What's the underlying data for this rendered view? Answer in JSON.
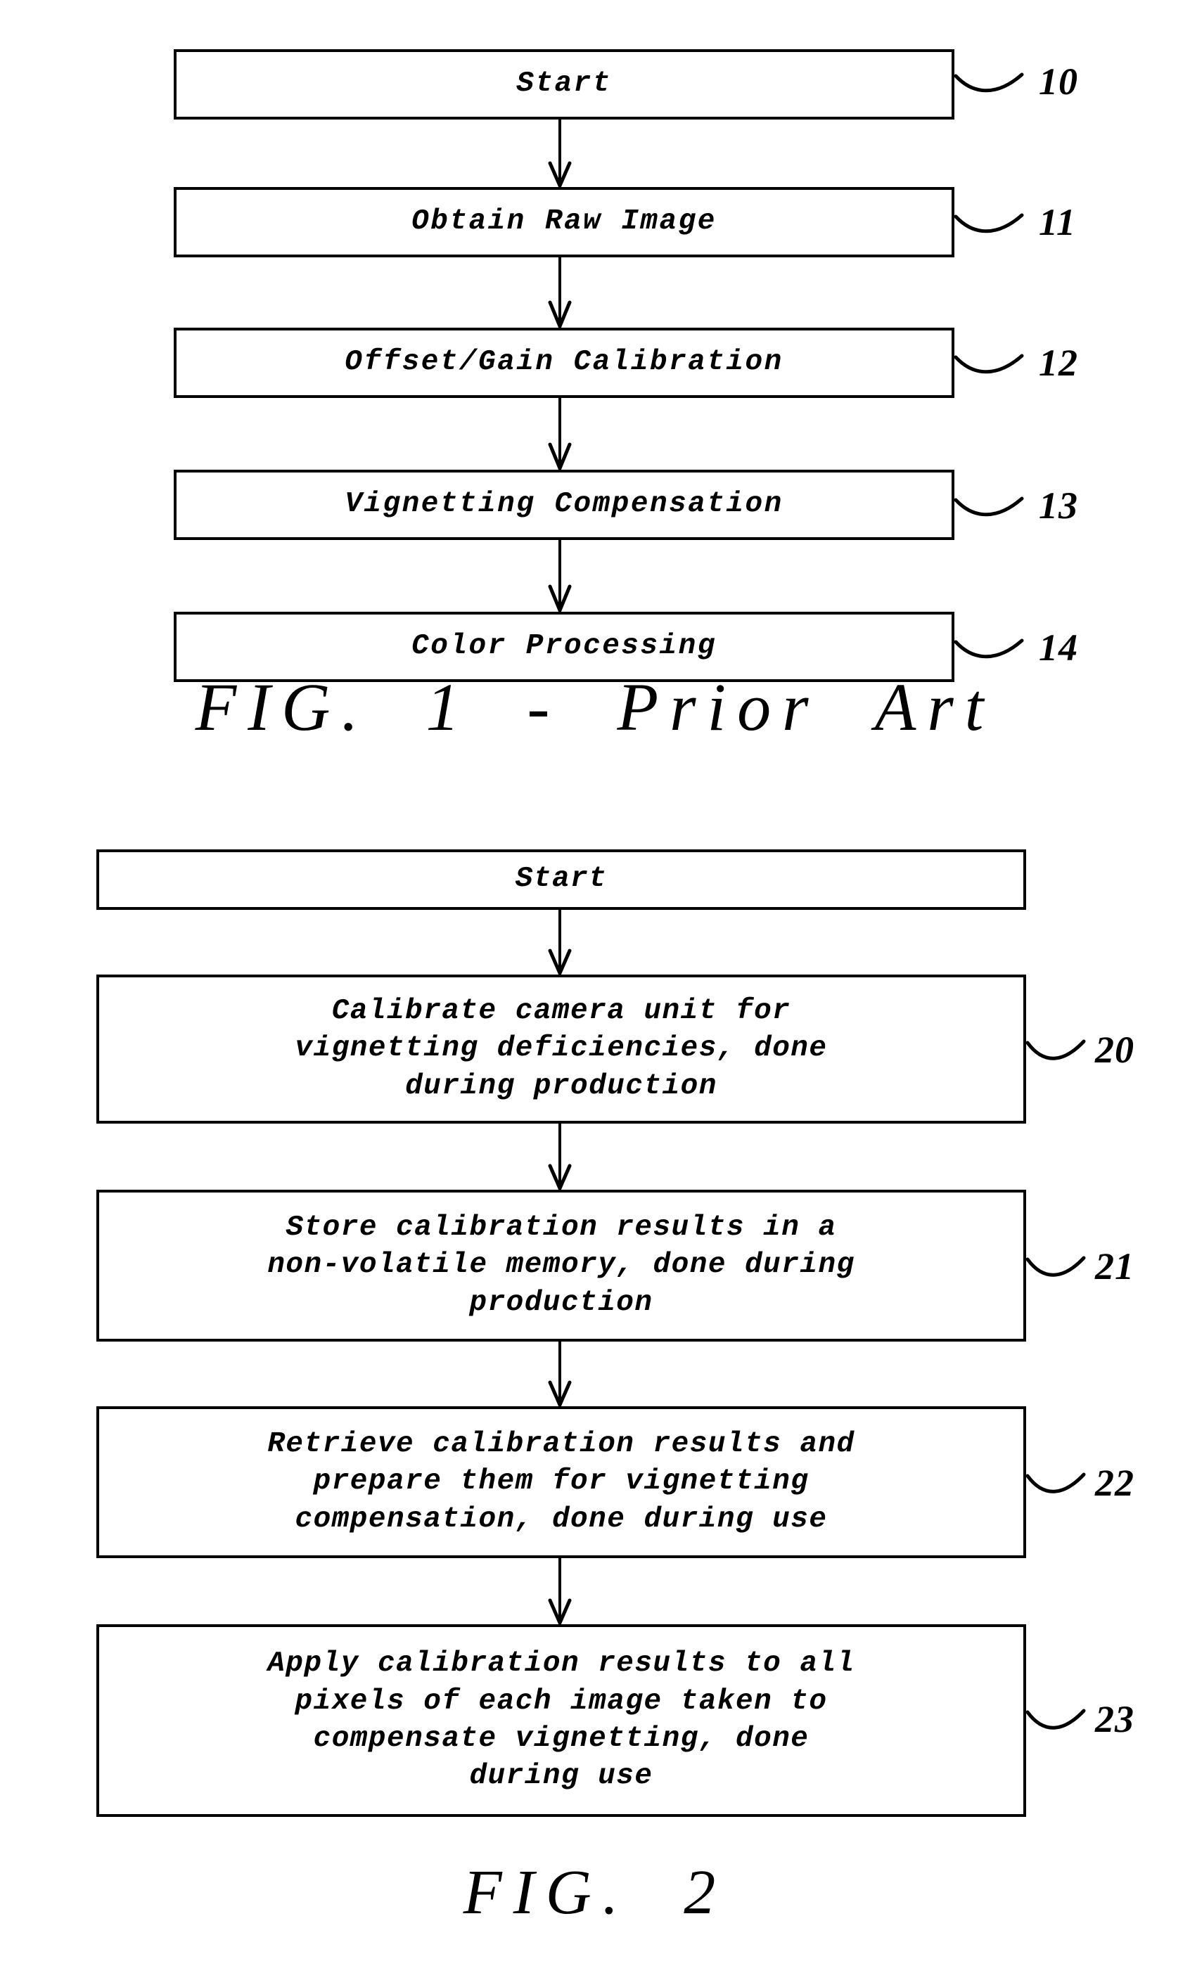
{
  "figures": [
    {
      "id": "fig1",
      "caption": "FIG.  1  -  Prior  Art",
      "steps": [
        {
          "label": "Start",
          "ref": "10"
        },
        {
          "label": "Obtain Raw Image",
          "ref": "11"
        },
        {
          "label": "Offset/Gain Calibration",
          "ref": "12"
        },
        {
          "label": "Vignetting Compensation",
          "ref": "13"
        },
        {
          "label": "Color Processing",
          "ref": "14"
        }
      ]
    },
    {
      "id": "fig2",
      "caption": "FIG.  2",
      "steps": [
        {
          "label": "Start",
          "ref": ""
        },
        {
          "label": "Calibrate camera unit for\nvignetting deficiencies, done\nduring production",
          "ref": "20"
        },
        {
          "label": "Store calibration results in a\nnon-volatile memory, done during\nproduction",
          "ref": "21"
        },
        {
          "label": "Retrieve calibration results and\nprepare them for vignetting\ncompensation, done during use",
          "ref": "22"
        },
        {
          "label": "Apply calibration results to all\npixels of each image taken to\ncompensate vignetting, done\nduring use",
          "ref": "23"
        }
      ]
    }
  ],
  "colors": {
    "ink": "#000000",
    "paper": "#ffffff"
  }
}
